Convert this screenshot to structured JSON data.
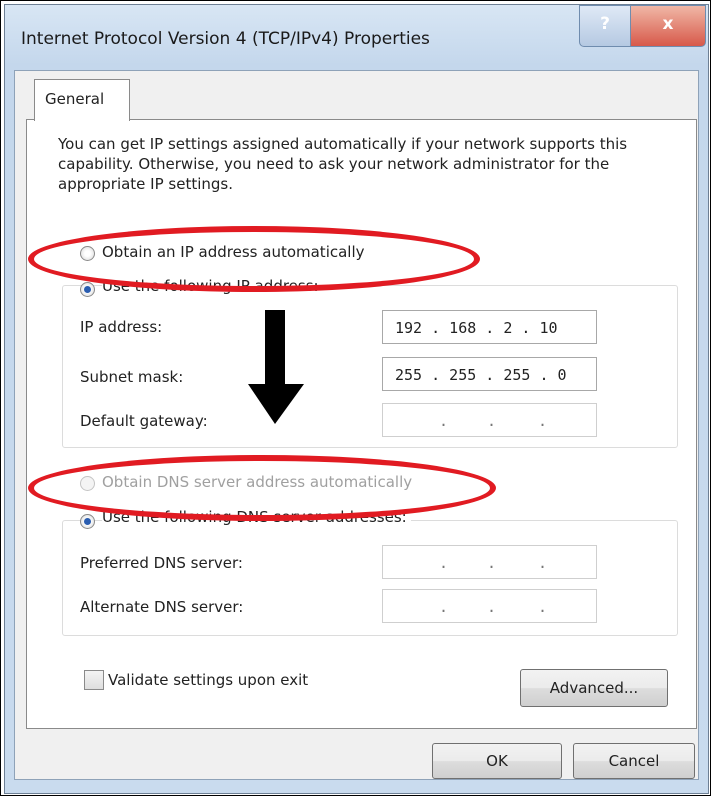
{
  "window": {
    "title": "Internet Protocol Version 4 (TCP/IPv4) Properties",
    "help_label": "?",
    "close_label": "x"
  },
  "tabs": [
    {
      "label": "General"
    }
  ],
  "description": "You can get IP settings assigned automatically if your network supports this capability. Otherwise, you need to ask your network administrator for the appropriate IP settings.",
  "ip_settings": {
    "obtain_auto_label": "Obtain an IP address automatically",
    "obtain_auto_selected": false,
    "use_following_label": "Use the following IP address:",
    "use_following_selected": true,
    "fields": [
      {
        "label": "IP address:",
        "value": "192 . 168 . 2 . 10"
      },
      {
        "label": "Subnet mask:",
        "value": "255 . 255 . 255 . 0"
      },
      {
        "label": "Default gateway:",
        "value": ""
      }
    ]
  },
  "dns_settings": {
    "obtain_auto_label": "Obtain DNS server address automatically",
    "obtain_auto_selected": false,
    "obtain_auto_enabled": false,
    "use_following_label": "Use the following DNS server addresses:",
    "use_following_selected": true,
    "fields": [
      {
        "label": "Preferred DNS server:",
        "value": ""
      },
      {
        "label": "Alternate DNS server:",
        "value": ""
      }
    ]
  },
  "validate_label": "Validate settings upon exit",
  "validate_checked": false,
  "buttons": {
    "advanced": "Advanced...",
    "ok": "OK",
    "cancel": "Cancel"
  },
  "annotation_color": "#e11b22"
}
